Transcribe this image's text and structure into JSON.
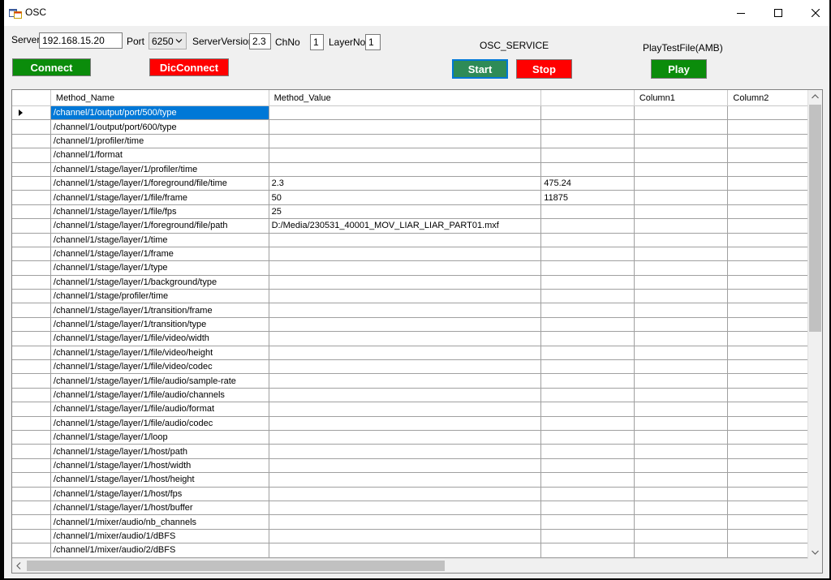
{
  "window": {
    "title": "OSC"
  },
  "toolbar": {
    "server_label": "Server",
    "server_value": "192.168.15.20",
    "port_label": "Port",
    "port_value": "6250",
    "server_version_label": "ServerVersion",
    "server_version_value": "2.3",
    "chno_label": "ChNo",
    "chno_value": "1",
    "layerno_label": "LayerNo",
    "layerno_value": "1",
    "connect_label": "Connect",
    "disconnect_label": "DicConnect",
    "osc_service_label": "OSC_SERVICE",
    "start_label": "Start",
    "stop_label": "Stop",
    "play_test_label": "PlayTestFile(AMB)",
    "play_label": "Play"
  },
  "colors": {
    "connect_green": "#0b8c0b",
    "stop_red": "#ff0000",
    "start_teal": "#2e8b57",
    "selection_blue": "#0078d7"
  },
  "grid": {
    "columns": [
      "",
      "Method_Name",
      "Method_Value",
      "",
      "Column1",
      "Column2"
    ],
    "selected_row": 0,
    "rows": [
      [
        "/channel/1/output/port/500/type",
        "",
        "",
        "",
        ""
      ],
      [
        "/channel/1/output/port/600/type",
        "",
        "",
        "",
        ""
      ],
      [
        "/channel/1/profiler/time",
        "",
        "",
        "",
        ""
      ],
      [
        "/channel/1/format",
        "",
        "",
        "",
        ""
      ],
      [
        "/channel/1/stage/layer/1/profiler/time",
        "",
        "",
        "",
        ""
      ],
      [
        "/channel/1/stage/layer/1/foreground/file/time",
        "2.3",
        "475.24",
        "",
        ""
      ],
      [
        "/channel/1/stage/layer/1/file/frame",
        "50",
        "11875",
        "",
        ""
      ],
      [
        "/channel/1/stage/layer/1/file/fps",
        "25",
        "",
        "",
        ""
      ],
      [
        "/channel/1/stage/layer/1/foreground/file/path",
        "D:/Media/230531_40001_MOV_LIAR_LIAR_PART01.mxf",
        "",
        "",
        ""
      ],
      [
        "/channel/1/stage/layer/1/time",
        "",
        "",
        "",
        ""
      ],
      [
        "/channel/1/stage/layer/1/frame",
        "",
        "",
        "",
        ""
      ],
      [
        "/channel/1/stage/layer/1/type",
        "",
        "",
        "",
        ""
      ],
      [
        "/channel/1/stage/layer/1/background/type",
        "",
        "",
        "",
        ""
      ],
      [
        "/channel/1/stage/profiler/time",
        "",
        "",
        "",
        ""
      ],
      [
        "/channel/1/stage/layer/1/transition/frame",
        "",
        "",
        "",
        ""
      ],
      [
        "/channel/1/stage/layer/1/transition/type",
        "",
        "",
        "",
        ""
      ],
      [
        "/channel/1/stage/layer/1/file/video/width",
        "",
        "",
        "",
        ""
      ],
      [
        "/channel/1/stage/layer/1/file/video/height",
        "",
        "",
        "",
        ""
      ],
      [
        "/channel/1/stage/layer/1/file/video/codec",
        "",
        "",
        "",
        ""
      ],
      [
        "/channel/1/stage/layer/1/file/audio/sample-rate",
        "",
        "",
        "",
        ""
      ],
      [
        "/channel/1/stage/layer/1/file/audio/channels",
        "",
        "",
        "",
        ""
      ],
      [
        "/channel/1/stage/layer/1/file/audio/format",
        "",
        "",
        "",
        ""
      ],
      [
        "/channel/1/stage/layer/1/file/audio/codec",
        "",
        "",
        "",
        ""
      ],
      [
        "/channel/1/stage/layer/1/loop",
        "",
        "",
        "",
        ""
      ],
      [
        "/channel/1/stage/layer/1/host/path",
        "",
        "",
        "",
        ""
      ],
      [
        "/channel/1/stage/layer/1/host/width",
        "",
        "",
        "",
        ""
      ],
      [
        "/channel/1/stage/layer/1/host/height",
        "",
        "",
        "",
        ""
      ],
      [
        "/channel/1/stage/layer/1/host/fps",
        "",
        "",
        "",
        ""
      ],
      [
        "/channel/1/stage/layer/1/host/buffer",
        "",
        "",
        "",
        ""
      ],
      [
        "/channel/1/mixer/audio/nb_channels",
        "",
        "",
        "",
        ""
      ],
      [
        "/channel/1/mixer/audio/1/dBFS",
        "",
        "",
        "",
        ""
      ],
      [
        "/channel/1/mixer/audio/2/dBFS",
        "",
        "",
        "",
        ""
      ]
    ]
  }
}
